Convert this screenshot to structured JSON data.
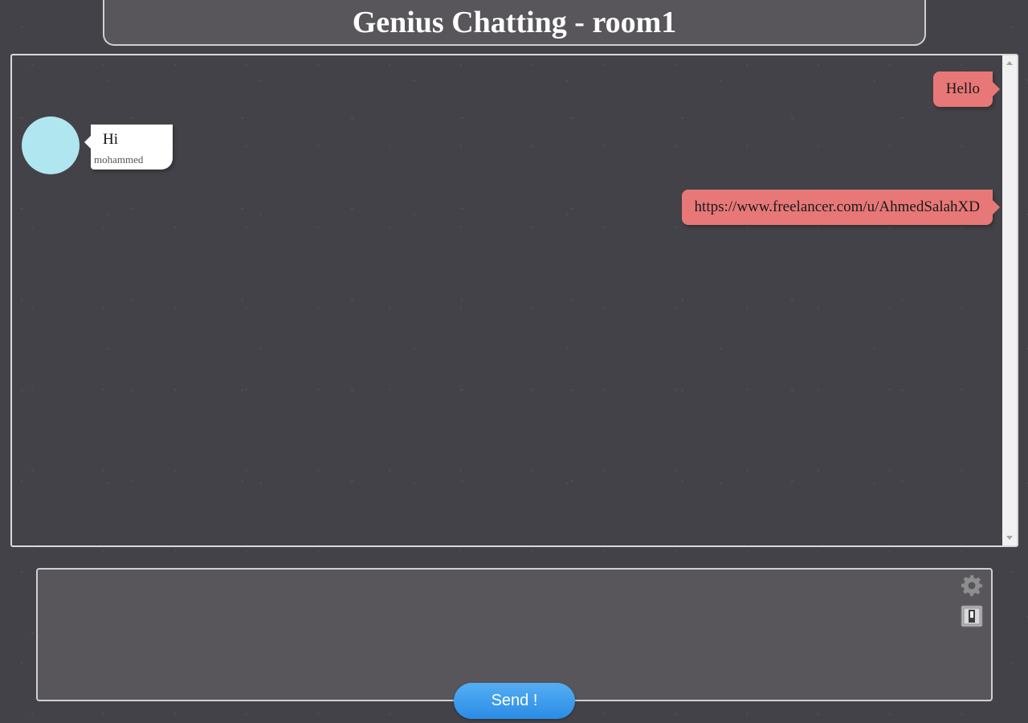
{
  "header": {
    "title": "Genius Chatting - room1"
  },
  "messages": {
    "outgoing": [
      {
        "text": "Hello"
      },
      {
        "text": "https://www.freelancer.com/u/AhmedSalahXD"
      }
    ],
    "incoming": [
      {
        "text": "Hi",
        "sender": "mohammed",
        "avatar_color": "#b0e6ef"
      }
    ]
  },
  "composer": {
    "value": "",
    "placeholder": "",
    "settings_icon": "gear-icon",
    "toggle_icon": "toggle-switch-icon",
    "send_label": "Send !"
  },
  "colors": {
    "background": "#434248",
    "panel": "#58565a",
    "outgoing_bubble": "#e77877",
    "incoming_bubble": "#ffffff",
    "send_button": "#3a9bec"
  }
}
